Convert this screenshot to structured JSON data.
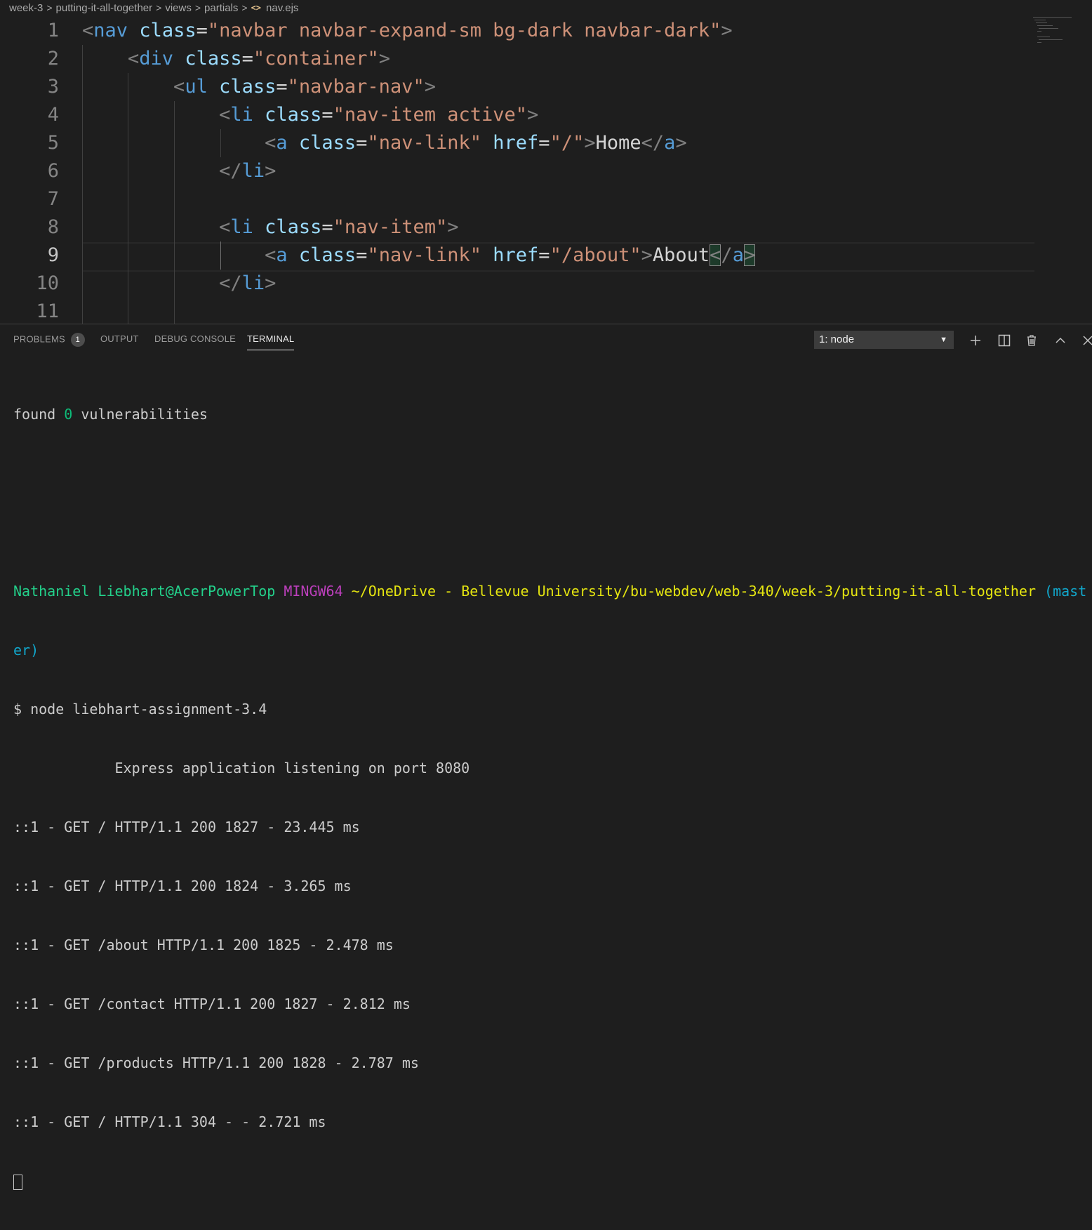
{
  "breadcrumb": {
    "items": [
      "week-3",
      "putting-it-all-together",
      "views",
      "partials"
    ],
    "file": "nav.ejs",
    "file_icon": "angle-brackets-icon"
  },
  "editor": {
    "line_numbers": [
      "1",
      "2",
      "3",
      "4",
      "5",
      "6",
      "7",
      "8",
      "9",
      "10",
      "11"
    ],
    "active_line": "9",
    "lines": [
      {
        "indent": "",
        "open": "<",
        "tag": "nav",
        "attrs": [
          {
            "name": "class",
            "value": "\"navbar navbar-expand-sm bg-dark navbar-dark\""
          }
        ],
        "close": ">",
        "text": "",
        "endtag": ""
      },
      {
        "indent": "    ",
        "open": "<",
        "tag": "div",
        "attrs": [
          {
            "name": "class",
            "value": "\"container\""
          }
        ],
        "close": ">",
        "text": "",
        "endtag": ""
      },
      {
        "indent": "        ",
        "open": "<",
        "tag": "ul",
        "attrs": [
          {
            "name": "class",
            "value": "\"navbar-nav\""
          }
        ],
        "close": ">",
        "text": "",
        "endtag": ""
      },
      {
        "indent": "            ",
        "open": "<",
        "tag": "li",
        "attrs": [
          {
            "name": "class",
            "value": "\"nav-item active\""
          }
        ],
        "close": ">",
        "text": "",
        "endtag": ""
      },
      {
        "indent": "                ",
        "open": "<",
        "tag": "a",
        "attrs": [
          {
            "name": "class",
            "value": "\"nav-link\""
          },
          {
            "name": "href",
            "value": "\"/\""
          }
        ],
        "close": ">",
        "text": "Home",
        "endtag": "a"
      },
      {
        "indent": "            ",
        "open": "</",
        "tag": "li",
        "attrs": [],
        "close": ">",
        "text": "",
        "endtag": ""
      },
      {
        "indent": "",
        "open": "",
        "tag": "",
        "attrs": [],
        "close": "",
        "text": "",
        "endtag": ""
      },
      {
        "indent": "            ",
        "open": "<",
        "tag": "li",
        "attrs": [
          {
            "name": "class",
            "value": "\"nav-item\""
          }
        ],
        "close": ">",
        "text": "",
        "endtag": ""
      },
      {
        "indent": "                ",
        "open": "<",
        "tag": "a",
        "attrs": [
          {
            "name": "class",
            "value": "\"nav-link\""
          },
          {
            "name": "href",
            "value": "\"/about\""
          }
        ],
        "close": ">",
        "text": "About",
        "endtag": "a"
      },
      {
        "indent": "            ",
        "open": "</",
        "tag": "li",
        "attrs": [],
        "close": ">",
        "text": "",
        "endtag": ""
      },
      {
        "indent": "",
        "open": "",
        "tag": "",
        "attrs": [],
        "close": "",
        "text": "",
        "endtag": ""
      }
    ]
  },
  "panel": {
    "tabs": [
      {
        "label": "PROBLEMS",
        "badge": "1"
      },
      {
        "label": "OUTPUT"
      },
      {
        "label": "DEBUG CONSOLE"
      },
      {
        "label": "TERMINAL",
        "active": true
      }
    ],
    "terminal_select": "1: node",
    "actions": [
      "plus-icon",
      "split-icon",
      "trash-icon",
      "chevron-up-icon",
      "close-icon"
    ]
  },
  "terminal": {
    "found_prefix": "found ",
    "found_count": "0",
    "found_suffix": " vulnerabilities",
    "prompt": {
      "user": "Nathaniel Liebhart@AcerPowerTop",
      "env": "MINGW64",
      "path": "~/OneDrive - Bellevue University/bu-webdev/web-340/week-3/putting-it-all-together",
      "branch_a": "(mast",
      "branch_b": "er)"
    },
    "command": "$ node liebhart-assignment-3.4",
    "output": [
      "            Express application listening on port 8080",
      "::1 - GET / HTTP/1.1 200 1827 - 23.445 ms",
      "::1 - GET / HTTP/1.1 200 1824 - 3.265 ms",
      "::1 - GET /about HTTP/1.1 200 1825 - 2.478 ms",
      "::1 - GET /contact HTTP/1.1 200 1827 - 2.812 ms",
      "::1 - GET /products HTTP/1.1 200 1828 - 2.787 ms",
      "::1 - GET / HTTP/1.1 304 - - 2.721 ms"
    ]
  },
  "colors": {
    "background": "#1e1e1e",
    "tag": "#569cd6",
    "attr": "#9cdcfe",
    "string": "#ce9178",
    "terminal_green": "#23d18b",
    "terminal_magenta": "#bc3fbc",
    "terminal_yellow": "#e5e510",
    "terminal_cyan": "#11a8cd"
  }
}
